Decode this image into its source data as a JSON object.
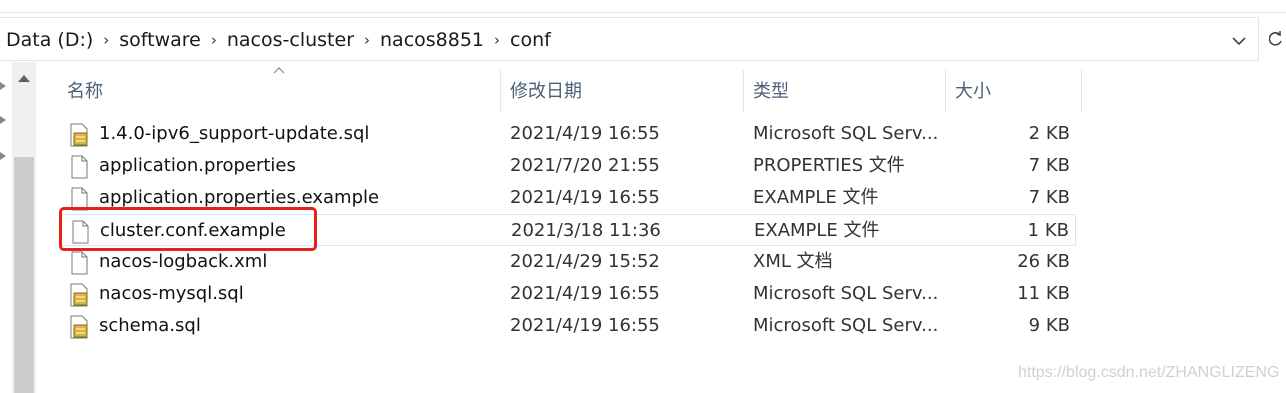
{
  "breadcrumb": [
    "Data (D:)",
    "software",
    "nacos-cluster",
    "nacos8851",
    "conf"
  ],
  "columns": {
    "name": "名称",
    "date": "修改日期",
    "type": "类型",
    "size": "大小"
  },
  "files": [
    {
      "name": "1.4.0-ipv6_support-update.sql",
      "date": "2021/4/19 16:55",
      "type": "Microsoft SQL Serv...",
      "size": "2 KB",
      "icon": "sql-file-icon"
    },
    {
      "name": "application.properties",
      "date": "2021/7/20 21:55",
      "type": "PROPERTIES 文件",
      "size": "7 KB",
      "icon": "file-icon"
    },
    {
      "name": "application.properties.example",
      "date": "2021/4/19 16:55",
      "type": "EXAMPLE 文件",
      "size": "7 KB",
      "icon": "file-icon"
    },
    {
      "name": "cluster.conf.example",
      "date": "2021/3/18 11:36",
      "type": "EXAMPLE 文件",
      "size": "1 KB",
      "icon": "file-icon"
    },
    {
      "name": "nacos-logback.xml",
      "date": "2021/4/29 15:52",
      "type": "XML 文档",
      "size": "26 KB",
      "icon": "file-icon"
    },
    {
      "name": "nacos-mysql.sql",
      "date": "2021/4/19 16:55",
      "type": "Microsoft SQL Serv...",
      "size": "11 KB",
      "icon": "sql-file-icon"
    },
    {
      "name": "schema.sql",
      "date": "2021/4/19 16:55",
      "type": "Microsoft SQL Serv...",
      "size": "9 KB",
      "icon": "sql-file-icon"
    }
  ],
  "selected_file": "cluster.conf.example",
  "highlight_color": "#e62117",
  "watermark": "https://blog.csdn.net/ZHANGLIZENG"
}
